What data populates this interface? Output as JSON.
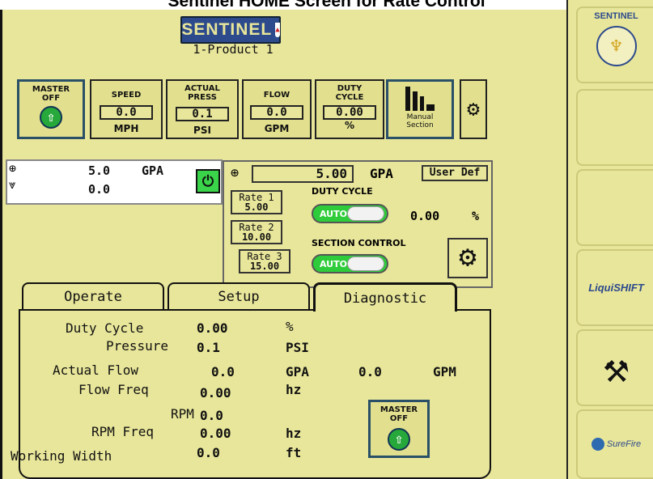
{
  "window_title": "Sentinel HOME Screen for Rate Control",
  "header": {
    "logo_text": "SENTINEL",
    "product": "1-Product 1"
  },
  "tiles": {
    "master": {
      "line1": "MASTER",
      "line2": "OFF"
    },
    "speed": {
      "label": "SPEED",
      "value": "0.0",
      "unit": "MPH"
    },
    "press": {
      "label1": "ACTUAL",
      "label2": "PRESS",
      "value": "0.1",
      "unit": "PSI"
    },
    "flow": {
      "label": "FLOW",
      "value": "0.0",
      "unit": "GPM"
    },
    "duty": {
      "label1": "DUTY",
      "label2": "CYCLE",
      "value": "0.00",
      "unit": "%"
    },
    "manual": {
      "line1": "Manual",
      "line2": "Section"
    }
  },
  "gpa_summary": {
    "target": "5.0",
    "unit": "GPA",
    "applied": "0.0"
  },
  "rate_panel": {
    "target_value": "5.00",
    "target_unit": "GPA",
    "user_def": "User Def",
    "rates": [
      {
        "label": "Rate 1",
        "value": "5.00"
      },
      {
        "label": "Rate 2",
        "value": "10.00"
      },
      {
        "label": "Rate 3",
        "value": "15.00"
      }
    ],
    "duty_cycle_label": "DUTY CYCLE",
    "duty_toggle": "AUTO",
    "duty_value": "0.00",
    "duty_unit": "%",
    "section_label": "SECTION CONTROL",
    "section_toggle": "AUTO"
  },
  "tabs": {
    "operate": "Operate",
    "setup": "Setup",
    "diagnostic": "Diagnostic",
    "active": "Diagnostic"
  },
  "diagnostic": {
    "duty_cycle": {
      "label": "Duty Cycle",
      "value": "0.00",
      "unit": "%"
    },
    "pressure": {
      "label": "Pressure",
      "value": "0.1",
      "unit": "PSI"
    },
    "actual_flow": {
      "label": "Actual Flow",
      "value": "0.0",
      "unit": "GPA",
      "value2": "0.0",
      "unit2": "GPM"
    },
    "flow_freq": {
      "label": "Flow Freq",
      "value": "0.00",
      "unit": "hz"
    },
    "rpm": {
      "label": "RPM",
      "value": "0.0"
    },
    "rpm_freq": {
      "label": "RPM Freq",
      "value": "0.00",
      "unit": "hz"
    },
    "working_width": {
      "label": "Working Width",
      "value": "0.0",
      "unit": "ft"
    },
    "master": {
      "line1": "MASTER",
      "line2": "OFF"
    }
  },
  "right_panel": {
    "brand_small": "SENTINEL",
    "liquishift": "LiquiSHIFT",
    "surefire": "SureFire"
  },
  "colors": {
    "background": "#e8e69a",
    "toggle_on": "#2ecc3a",
    "power_on": "#3ad44a",
    "arrow_button": "#27a83a",
    "logo_bg": "#2d4a8c"
  }
}
